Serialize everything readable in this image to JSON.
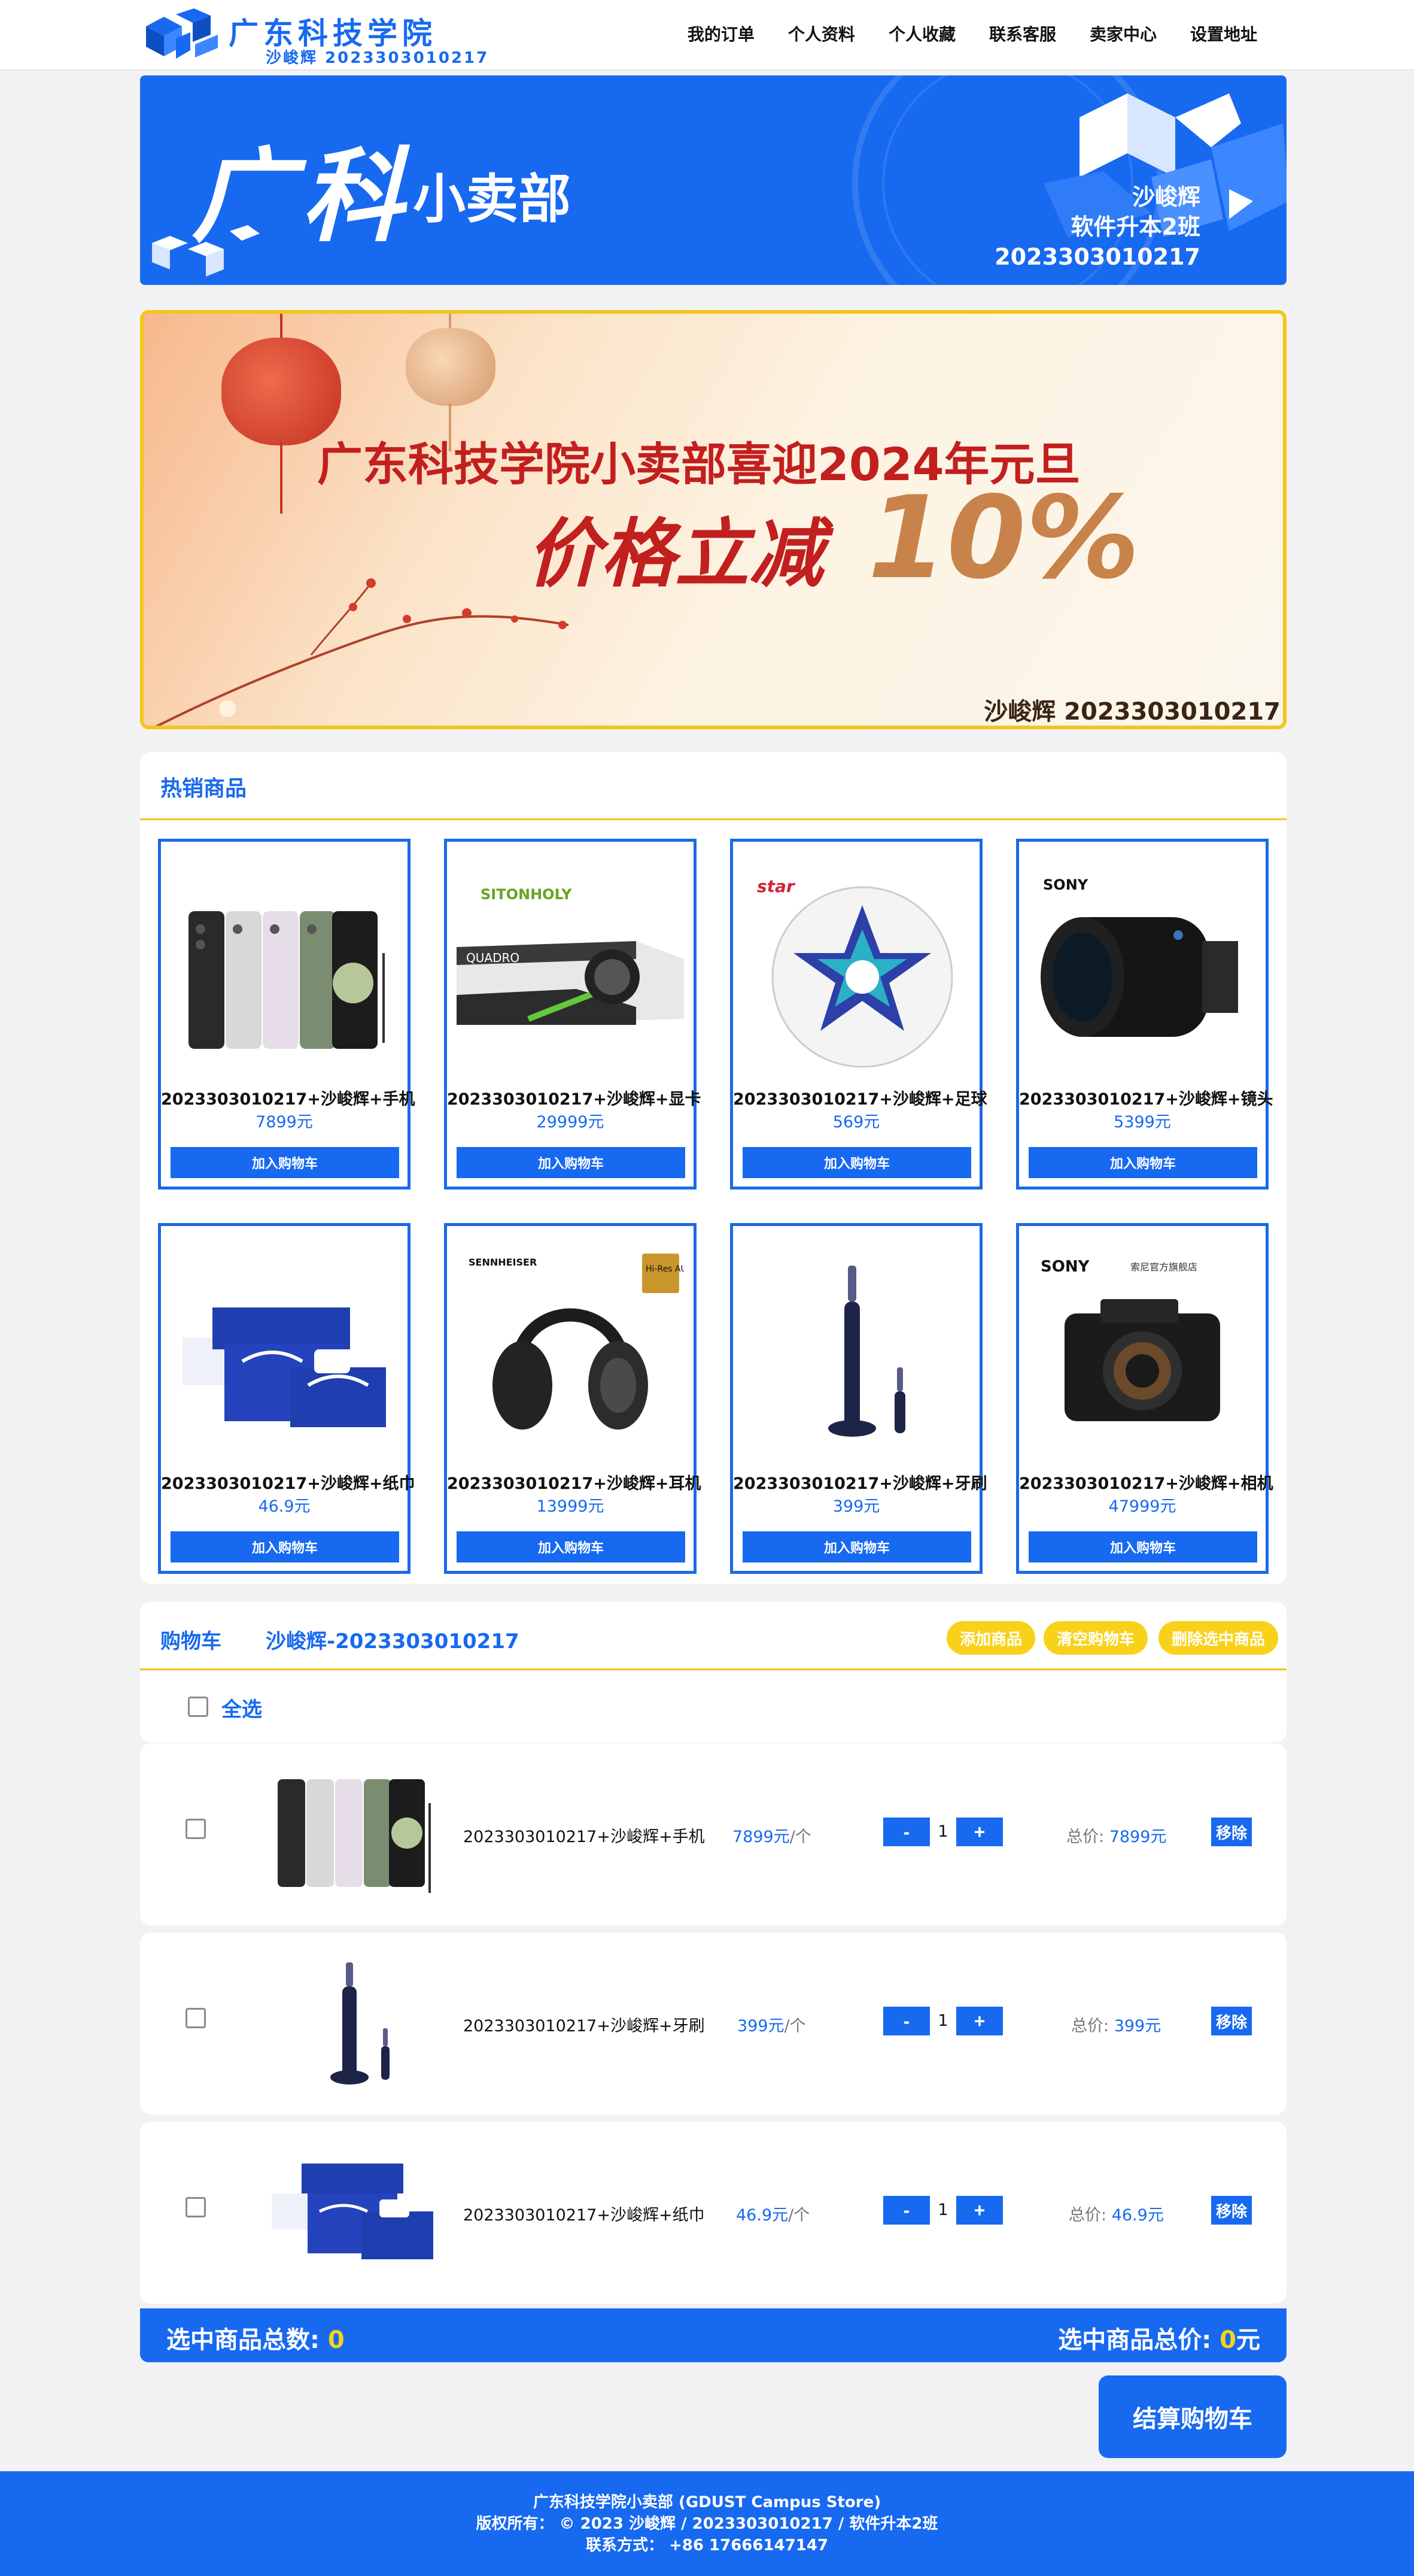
{
  "nav": {
    "logo_title": "广东科技学院",
    "logo_sub": "沙峻辉 2023303010217",
    "links": [
      "我的订单",
      "个人资料",
      "个人收藏",
      "联系客服",
      "卖家中心",
      "设置地址"
    ]
  },
  "hero": {
    "big": "广科",
    "small": "小卖部",
    "name": "沙峻辉",
    "class": "软件升本2班",
    "id": "2023303010217"
  },
  "promo": {
    "title": "广东科技学院小卖部喜迎2024年元旦",
    "cut": "价格立减",
    "pct": "10%",
    "sign": "沙峻辉 2023303010217"
  },
  "hot": {
    "title": "热销商品",
    "add_label": "加入购物车",
    "products": [
      {
        "name": "2023303010217+沙峻辉+手机",
        "price": "7899元",
        "icon": "phone"
      },
      {
        "name": "2023303010217+沙峻辉+显卡",
        "price": "29999元",
        "icon": "gpu"
      },
      {
        "name": "2023303010217+沙峻辉+足球",
        "price": "569元",
        "icon": "football"
      },
      {
        "name": "2023303010217+沙峻辉+镜头",
        "price": "5399元",
        "icon": "lens"
      },
      {
        "name": "2023303010217+沙峻辉+纸巾",
        "price": "46.9元",
        "icon": "tissue"
      },
      {
        "name": "2023303010217+沙峻辉+耳机",
        "price": "13999元",
        "icon": "headphones"
      },
      {
        "name": "2023303010217+沙峻辉+牙刷",
        "price": "399元",
        "icon": "toothbrush"
      },
      {
        "name": "2023303010217+沙峻辉+相机",
        "price": "47999元",
        "icon": "camera"
      }
    ],
    "brands": {
      "gpu": "SITONHOLY",
      "football": "star",
      "lens": "SONY",
      "headphones": "SENNHEISER",
      "hires": "Hi-Res AUDIO",
      "camera": "SONY",
      "camera_store": "索尼官方旗舰店",
      "gpu_card": "QUADRO"
    }
  },
  "cart": {
    "title": "购物车",
    "user": "沙峻辉-2023303010217",
    "buttons": [
      "添加商品",
      "清空购物车",
      "删除选中商品"
    ],
    "select_all": "全选",
    "unit_suffix": "/个",
    "total_label": "总价:",
    "remove_label": "移除",
    "minus": "-",
    "plus": "+",
    "items": [
      {
        "name": "2023303010217+沙峻辉+手机",
        "unit": "7899元",
        "qty": "1",
        "total": "7899元",
        "icon": "phone"
      },
      {
        "name": "2023303010217+沙峻辉+牙刷",
        "unit": "399元",
        "qty": "1",
        "total": "399元",
        "icon": "toothbrush"
      },
      {
        "name": "2023303010217+沙峻辉+纸巾",
        "unit": "46.9元",
        "qty": "1",
        "total": "46.9元",
        "icon": "tissue"
      }
    ],
    "count_label": "选中商品总数: ",
    "count_value": "0",
    "sum_label": "选中商品总价: ",
    "sum_value": "0",
    "sum_unit": "元",
    "checkout": "结算购物车"
  },
  "footer": {
    "line1": "广东科技学院小卖部 (GDUST Campus Store)",
    "line2": "版权所有： © 2023 沙峻辉 / 2023303010217 / 软件升本2班",
    "line3": "联系方式： +86 17666147147"
  },
  "colors": {
    "primary": "#1769f0",
    "accent": "#f8d21a",
    "promo_red": "#c21f1f"
  }
}
